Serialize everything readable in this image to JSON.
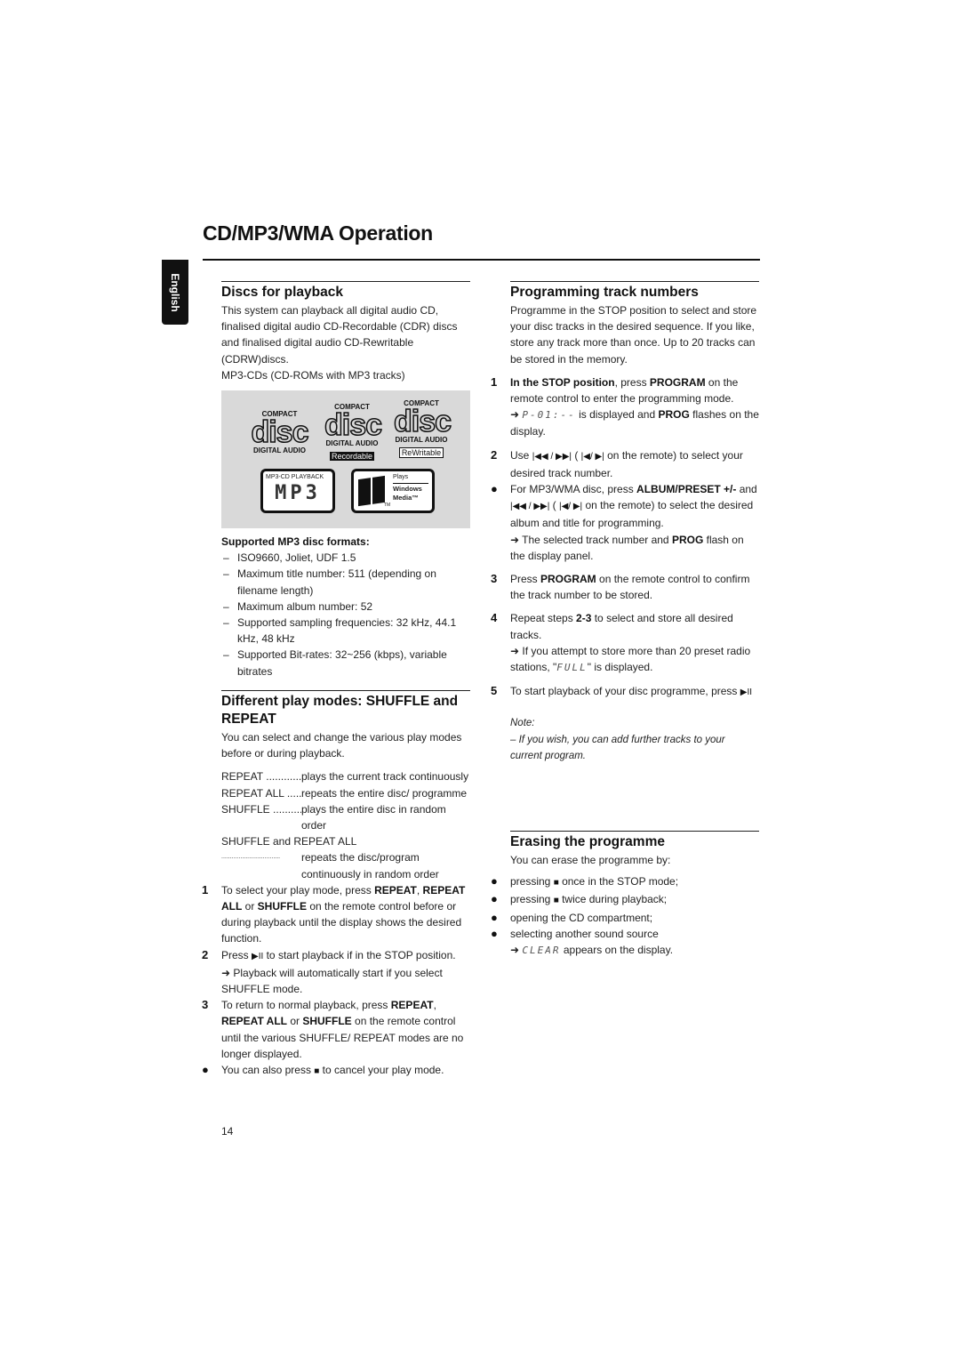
{
  "page": {
    "title": "CD/MP3/WMA Operation",
    "language_tab": "English",
    "page_number": "14"
  },
  "discs": {
    "heading": "Discs for playback",
    "paras": [
      "This system can playback all digital audio CD, finalised digital audio CD-Recordable (CDR) discs and finalised digital audio CD-Rewritable (CDRW)discs.",
      "MP3-CDs (CD-ROMs with MP3 tracks)"
    ],
    "logos": {
      "compact": "COMPACT",
      "disc": "disc",
      "digital_audio": "DIGITAL AUDIO",
      "recordable": "Recordable",
      "rewritable": "ReWritable",
      "mp3_playback": "MP3-CD PLAYBACK",
      "mp3": "MP3",
      "plays": "Plays",
      "windows": "Windows",
      "media": "Media™",
      "tm": "TM"
    },
    "formats_heading": "Supported MP3 disc formats:",
    "formats": [
      "ISO9660, Joliet, UDF 1.5",
      "Maximum title number: 511 (depending on filename length)",
      "Maximum album number: 52",
      "Supported sampling frequencies: 32 kHz, 44.1 kHz, 48 kHz",
      "Supported Bit-rates: 32~256 (kbps), variable bitrates"
    ]
  },
  "modes": {
    "heading": "Different play modes: SHUFFLE and REPEAT",
    "intro": "You can select and change the various play modes before or during playback.",
    "defs": [
      {
        "term": "REPEAT",
        "desc": "plays the current track continuously"
      },
      {
        "term": "REPEAT ALL",
        "desc": "repeats the entire disc/ programme"
      },
      {
        "term": "SHUFFLE",
        "desc": "plays the entire disc in random order"
      }
    ],
    "combo_term": "SHUFFLE and REPEAT ALL",
    "combo_desc": "repeats the disc/program continuously in random order",
    "steps": [
      {
        "mark": "1",
        "segs": [
          [
            "To select your play mode, press ",
            ""
          ],
          [
            "REPEAT",
            "b"
          ],
          [
            ", ",
            ""
          ],
          [
            "REPEAT ALL",
            "b"
          ],
          [
            " or ",
            ""
          ],
          [
            "SHUFFLE",
            "b"
          ],
          [
            " on the remote control before or during playback until the display shows the desired function.",
            ""
          ]
        ]
      },
      {
        "mark": "2",
        "segs": [
          [
            "Press ",
            ""
          ],
          [
            "▶II",
            "sym"
          ],
          [
            " to start playback if in the STOP position.",
            ""
          ]
        ],
        "sub": [
          [
            "➜ Playback will automatically start if you select SHUFFLE mode.",
            ""
          ]
        ]
      },
      {
        "mark": "3",
        "segs": [
          [
            "To return to normal playback, press ",
            ""
          ],
          [
            "REPEAT",
            "b"
          ],
          [
            ", ",
            ""
          ],
          [
            "REPEAT ALL",
            "b"
          ],
          [
            " or ",
            ""
          ],
          [
            "SHUFFLE",
            "b"
          ],
          [
            " on the remote control until the various SHUFFLE/ REPEAT modes are no longer displayed.",
            ""
          ]
        ]
      },
      {
        "mark": "●",
        "segs": [
          [
            "You can also press ",
            ""
          ],
          [
            "■",
            "sym"
          ],
          [
            " to cancel your play mode.",
            ""
          ]
        ]
      }
    ]
  },
  "programming": {
    "heading": "Programming track numbers",
    "intro": "Programme in the STOP position to select and store your disc tracks in the desired sequence. If you like, store any track more than once. Up to 20 tracks can be stored in the memory.",
    "steps": [
      {
        "mark": "1",
        "segs": [
          [
            "In the STOP position",
            "b"
          ],
          [
            ", press ",
            ""
          ],
          [
            "PROGRAM",
            "b"
          ],
          [
            " on the remote control to enter the programming mode.",
            ""
          ]
        ],
        "sub": [
          [
            "➜ ",
            ""
          ],
          [
            "P-01:--",
            "lcd"
          ],
          [
            " is displayed and ",
            ""
          ],
          [
            "PROG",
            "b"
          ],
          [
            " flashes on the display.",
            ""
          ]
        ],
        "gap": true
      },
      {
        "mark": "2",
        "segs": [
          [
            "Use ",
            ""
          ],
          [
            "|◀◀ / ▶▶|",
            "sym"
          ],
          [
            " ( ",
            ""
          ],
          [
            "|◀/ ▶|",
            "sym"
          ],
          [
            " on the remote) to select your desired track number.",
            ""
          ]
        ]
      },
      {
        "mark": "●",
        "segs": [
          [
            "For MP3/WMA disc, press ",
            ""
          ],
          [
            "ALBUM/PRESET +/-",
            "b"
          ],
          [
            " and ",
            ""
          ],
          [
            "|◀◀ / ▶▶|",
            "sym"
          ],
          [
            " ( ",
            ""
          ],
          [
            "|◀/ ▶|",
            "sym"
          ],
          [
            " on the remote) to select the desired album and title for programming.",
            ""
          ]
        ],
        "sub": [
          [
            "➜ The selected track number and ",
            ""
          ],
          [
            "PROG",
            "b"
          ],
          [
            " flash on the display panel.",
            ""
          ]
        ],
        "gap": true
      },
      {
        "mark": "3",
        "segs": [
          [
            "Press ",
            ""
          ],
          [
            "PROGRAM",
            "b"
          ],
          [
            " on the remote control to confirm the track number to be stored.",
            ""
          ]
        ],
        "gap": true
      },
      {
        "mark": "4",
        "segs": [
          [
            "Repeat steps ",
            ""
          ],
          [
            "2-3",
            "b"
          ],
          [
            " to select and store all desired tracks.",
            ""
          ]
        ],
        "sub": [
          [
            "➜ If you attempt to store more than 20 preset radio stations, \"",
            ""
          ],
          [
            "FULL",
            "lcd"
          ],
          [
            "\" is displayed.",
            ""
          ]
        ],
        "gap": true
      },
      {
        "mark": "5",
        "segs": [
          [
            "To start playback of your disc programme, press ",
            ""
          ],
          [
            "▶II",
            "sym"
          ]
        ]
      }
    ],
    "note_label": "Note:",
    "note_text": "– If you wish, you can add further tracks to your current program."
  },
  "erasing": {
    "heading": "Erasing the programme",
    "intro": "You can erase the programme by:",
    "steps": [
      {
        "mark": "●",
        "segs": [
          [
            "pressing ",
            ""
          ],
          [
            "■",
            "sym"
          ],
          [
            " once in the STOP mode;",
            ""
          ]
        ]
      },
      {
        "mark": "●",
        "segs": [
          [
            "pressing ",
            ""
          ],
          [
            "■",
            "sym"
          ],
          [
            " twice during playback;",
            ""
          ]
        ]
      },
      {
        "mark": "●",
        "segs": [
          [
            "opening the CD compartment;",
            ""
          ]
        ]
      },
      {
        "mark": "●",
        "segs": [
          [
            "selecting another sound source",
            ""
          ]
        ],
        "sub": [
          [
            "➜ ",
            ""
          ],
          [
            "CLEAR",
            "lcd"
          ],
          [
            " appears on the display.",
            ""
          ]
        ]
      }
    ]
  }
}
